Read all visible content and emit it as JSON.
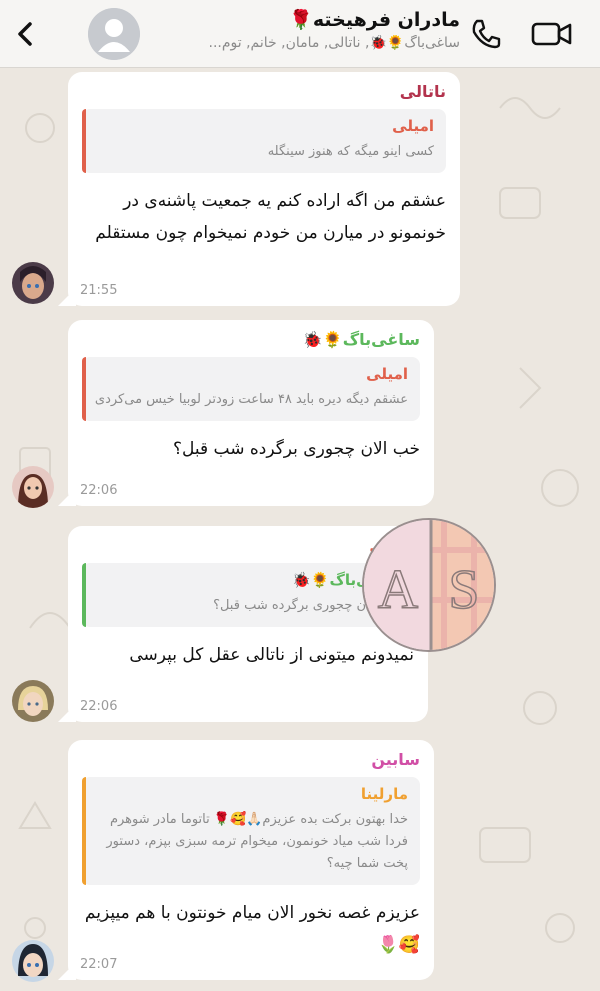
{
  "header": {
    "title": "مادران فرهیخته🌹",
    "subtitle": "ساغی‌باگ🌻🐞, ناتالی, مامان, خانم, توم..."
  },
  "messages": [
    {
      "sender": "ناتالی",
      "quote_name": "امیلی",
      "quote_text": "کسی اینو میگه که هنوز سینگله",
      "text": "عشقم من اگه اراده کنم یه جمعیت پاشنه‌ی در خونمونو در میارن من خودم نمیخوام چون مستقلم",
      "time": "21:55"
    },
    {
      "sender": "ساغی‌باگ🌻🐞",
      "quote_name": "امیلی",
      "quote_text": "عشقم دیگه دیره باید ۴۸ ساعت زودتر لوبیا خیس می‌کردی",
      "text": "خب الان چجوری برگرده شب قبل؟",
      "time": "22:06"
    },
    {
      "sender": "امیلی",
      "quote_name": "ساغی‌باگ🌻🐞",
      "quote_text": "خب الان چجوری برگرده شب قبل؟",
      "text": "نمیدونم میتونی از ناتالی عقل کل بپرسی",
      "time": "22:06"
    },
    {
      "sender": "سابین",
      "quote_name": "مارلینا",
      "quote_text": "خدا بهتون برکت بده عزیزم🙏🏻🥰🌹 تاتوما مادر شوهرم فردا شب میاد خونمون، میخوام ترمه سبزی بپزم، دستور پخت شما چیه؟",
      "text": "عزیزم غصه نخور الان میام خونتون با هم میپزیم🥰🌷",
      "time": "22:07"
    }
  ],
  "watermark": {
    "left": "A",
    "right": "S"
  },
  "colors": {
    "natali": "#b3334d",
    "saghi": "#5cb85c",
    "emily": "#e0604a",
    "sabin": "#d14fa6",
    "marlina": "#f0a030"
  }
}
